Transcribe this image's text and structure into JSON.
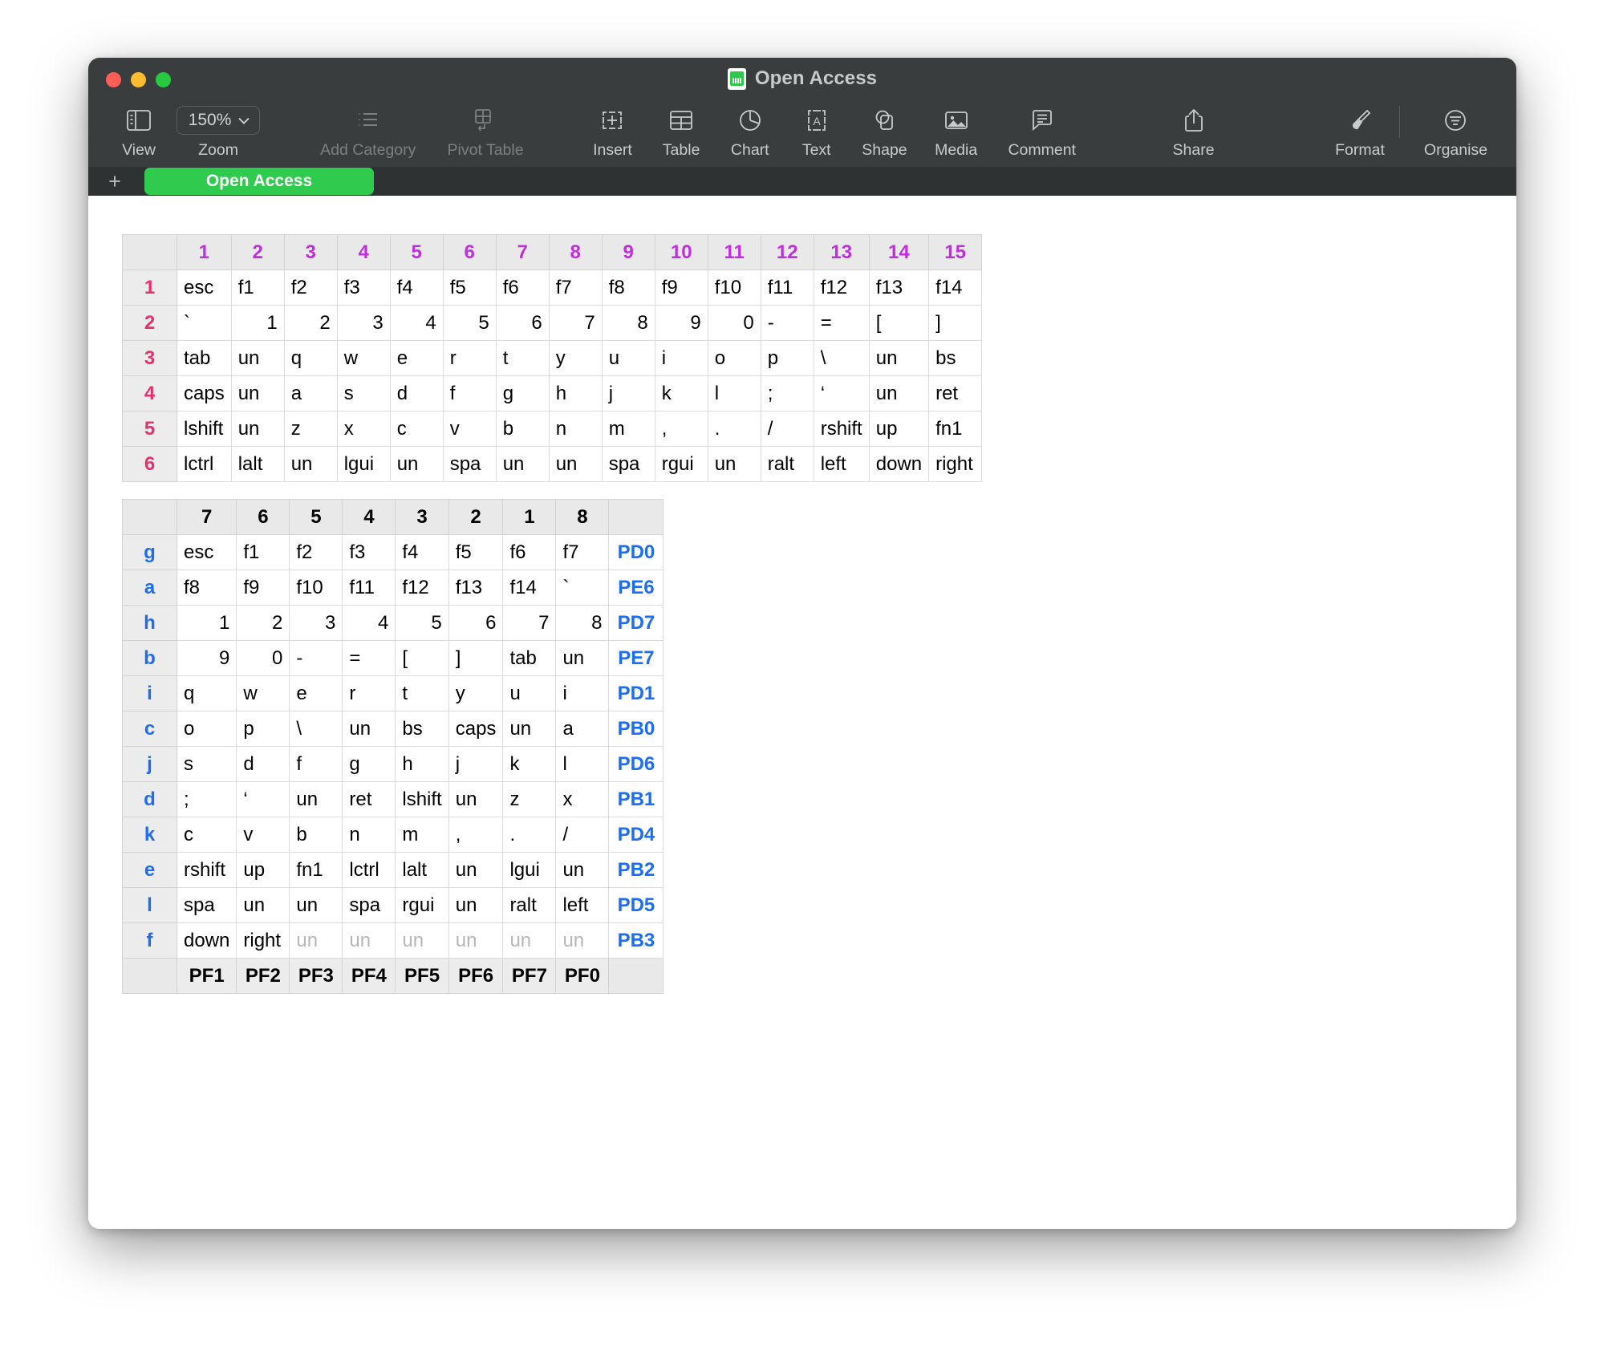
{
  "window": {
    "title": "Open Access",
    "doc_icon": "numbers-document-icon",
    "traffic_lights": [
      "close",
      "minimize",
      "zoom"
    ],
    "colors": {
      "chrome": "#3a3d3e",
      "tabbar": "#2f3233",
      "sheet_tab": "#2ecb4e",
      "col_header_text_table1": "#c02ee0",
      "row_header_text_table1": "#e8306b",
      "row_header_text_table2": "#1a6ef5",
      "muted_cell_text": "#b6b6b6"
    }
  },
  "toolbar": {
    "zoom_value": "150%",
    "items": [
      {
        "label": "View",
        "icon": "sidebar-icon",
        "enabled": true
      },
      {
        "label": "Zoom",
        "icon": "zoom-dropdown",
        "enabled": true
      },
      {
        "label": "Add Category",
        "icon": "list-icon",
        "enabled": false
      },
      {
        "label": "Pivot Table",
        "icon": "pivot-table-icon",
        "enabled": false
      },
      {
        "label": "Insert",
        "icon": "insert-icon",
        "enabled": true
      },
      {
        "label": "Table",
        "icon": "table-icon",
        "enabled": true
      },
      {
        "label": "Chart",
        "icon": "chart-pie-icon",
        "enabled": true
      },
      {
        "label": "Text",
        "icon": "text-box-icon",
        "enabled": true
      },
      {
        "label": "Shape",
        "icon": "shape-icon",
        "enabled": true
      },
      {
        "label": "Media",
        "icon": "media-image-icon",
        "enabled": true
      },
      {
        "label": "Comment",
        "icon": "comment-icon",
        "enabled": true
      },
      {
        "label": "Share",
        "icon": "share-icon",
        "enabled": true
      },
      {
        "label": "Format",
        "icon": "format-brush-icon",
        "enabled": true
      },
      {
        "label": "Organise",
        "icon": "organise-icon",
        "enabled": true
      }
    ]
  },
  "sheet_bar": {
    "add_label": "+",
    "tabs": [
      {
        "label": "Open Access",
        "active": true
      }
    ]
  },
  "table1": {
    "col_headers": [
      "1",
      "2",
      "3",
      "4",
      "5",
      "6",
      "7",
      "8",
      "9",
      "10",
      "11",
      "12",
      "13",
      "14",
      "15"
    ],
    "row_headers": [
      "1",
      "2",
      "3",
      "4",
      "5",
      "6"
    ],
    "rows": [
      [
        "esc",
        "f1",
        "f2",
        "f3",
        "f4",
        "f5",
        "f6",
        "f7",
        "f8",
        "f9",
        "f10",
        "f11",
        "f12",
        "f13",
        "f14"
      ],
      [
        "`",
        "1",
        "2",
        "3",
        "4",
        "5",
        "6",
        "7",
        "8",
        "9",
        "0",
        "-",
        "=",
        "[",
        "]"
      ],
      [
        "tab",
        "un",
        "q",
        "w",
        "e",
        "r",
        "t",
        "y",
        "u",
        "i",
        "o",
        "p",
        "\\",
        "un",
        "bs"
      ],
      [
        "caps",
        "un",
        "a",
        "s",
        "d",
        "f",
        "g",
        "h",
        "j",
        "k",
        "l",
        ";",
        "‘",
        "un",
        "ret"
      ],
      [
        "lshift",
        "un",
        "z",
        "x",
        "c",
        "v",
        "b",
        "n",
        "m",
        ",",
        ".",
        "/",
        "rshift",
        "up",
        "fn1"
      ],
      [
        "lctrl",
        "lalt",
        "un",
        "lgui",
        "un",
        "spa",
        "un",
        "un",
        "spa",
        "rgui",
        "un",
        "ralt",
        "left",
        "down",
        "right"
      ]
    ],
    "numeric_row_index": 1
  },
  "table2": {
    "col_headers": [
      "7",
      "6",
      "5",
      "4",
      "3",
      "2",
      "1",
      "8"
    ],
    "row_headers": [
      "g",
      "a",
      "h",
      "b",
      "i",
      "c",
      "j",
      "d",
      "k",
      "e",
      "l",
      "f"
    ],
    "pin_column": [
      "PD0",
      "PE6",
      "PD7",
      "PE7",
      "PD1",
      "PB0",
      "PD6",
      "PB1",
      "PD4",
      "PB2",
      "PD5",
      "PB3"
    ],
    "footer": [
      "PF1",
      "PF2",
      "PF3",
      "PF4",
      "PF5",
      "PF6",
      "PF7",
      "PF0"
    ],
    "rows": [
      {
        "cells": [
          "esc",
          "f1",
          "f2",
          "f3",
          "f4",
          "f5",
          "f6",
          "f7"
        ],
        "numeric": false,
        "muted_from": null
      },
      {
        "cells": [
          "f8",
          "f9",
          "f10",
          "f11",
          "f12",
          "f13",
          "f14",
          "`"
        ],
        "numeric": false,
        "muted_from": null
      },
      {
        "cells": [
          "1",
          "2",
          "3",
          "4",
          "5",
          "6",
          "7",
          "8"
        ],
        "numeric": true,
        "muted_from": null
      },
      {
        "cells": [
          "9",
          "0",
          "-",
          "=",
          "[",
          "]",
          "tab",
          "un"
        ],
        "numeric": false,
        "muted_from": null,
        "numeric_cells": [
          0,
          1
        ]
      },
      {
        "cells": [
          "q",
          "w",
          "e",
          "r",
          "t",
          "y",
          "u",
          "i"
        ],
        "numeric": false,
        "muted_from": null
      },
      {
        "cells": [
          "o",
          "p",
          "\\",
          "un",
          "bs",
          "caps",
          "un",
          "a"
        ],
        "numeric": false,
        "muted_from": null
      },
      {
        "cells": [
          "s",
          "d",
          "f",
          "g",
          "h",
          "j",
          "k",
          "l"
        ],
        "numeric": false,
        "muted_from": null
      },
      {
        "cells": [
          ";",
          "‘",
          "un",
          "ret",
          "lshift",
          "un",
          "z",
          "x"
        ],
        "numeric": false,
        "muted_from": null
      },
      {
        "cells": [
          "c",
          "v",
          "b",
          "n",
          "m",
          ",",
          ".",
          "/"
        ],
        "numeric": false,
        "muted_from": null
      },
      {
        "cells": [
          "rshift",
          "up",
          "fn1",
          "lctrl",
          "lalt",
          "un",
          "lgui",
          "un"
        ],
        "numeric": false,
        "muted_from": null
      },
      {
        "cells": [
          "spa",
          "un",
          "un",
          "spa",
          "rgui",
          "un",
          "ralt",
          "left"
        ],
        "numeric": false,
        "muted_from": null
      },
      {
        "cells": [
          "down",
          "right",
          "un",
          "un",
          "un",
          "un",
          "un",
          "un"
        ],
        "numeric": false,
        "muted_from": 2
      }
    ]
  }
}
